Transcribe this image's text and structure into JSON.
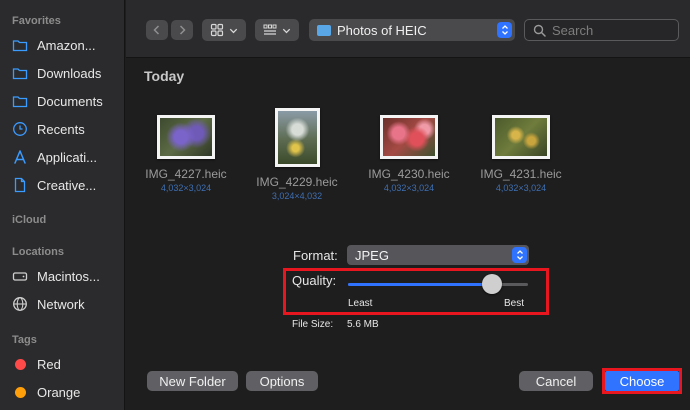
{
  "sidebar": {
    "favorites_title": "Favorites",
    "favorites": [
      {
        "label": "Amazon...",
        "icon": "folder-icon"
      },
      {
        "label": "Downloads",
        "icon": "folder-icon"
      },
      {
        "label": "Documents",
        "icon": "folder-icon"
      },
      {
        "label": "Recents",
        "icon": "clock-icon"
      },
      {
        "label": "Applicati...",
        "icon": "applications-icon"
      },
      {
        "label": "Creative...",
        "icon": "document-icon"
      }
    ],
    "icloud_title": "iCloud",
    "locations_title": "Locations",
    "locations": [
      {
        "label": "Macintos...",
        "icon": "drive-icon"
      },
      {
        "label": "Network",
        "icon": "globe-icon"
      }
    ],
    "tags_title": "Tags",
    "tags": [
      {
        "label": "Red",
        "color": "#ff4a4a"
      },
      {
        "label": "Orange",
        "color": "#ff9f0a"
      }
    ]
  },
  "toolbar": {
    "location": "Photos of HEIC",
    "search_placeholder": "Search"
  },
  "content": {
    "section": "Today",
    "files": [
      {
        "name": "IMG_4227.heic",
        "dims": "4,032×3,024"
      },
      {
        "name": "IMG_4229.heic",
        "dims": "3,024×4,032"
      },
      {
        "name": "IMG_4230.heic",
        "dims": "4,032×3,024"
      },
      {
        "name": "IMG_4231.heic",
        "dims": "4,032×3,024"
      }
    ]
  },
  "options": {
    "format_label": "Format:",
    "format_value": "JPEG",
    "quality_label": "Quality:",
    "quality_value": 0.8,
    "quality_min_label": "Least",
    "quality_max_label": "Best",
    "filesize_label": "File Size:",
    "filesize_value": "5.6 MB"
  },
  "buttons": {
    "new_folder": "New Folder",
    "options": "Options",
    "cancel": "Cancel",
    "choose": "Choose"
  },
  "colors": {
    "accent": "#2f73ff",
    "highlight": "#e8161f"
  }
}
